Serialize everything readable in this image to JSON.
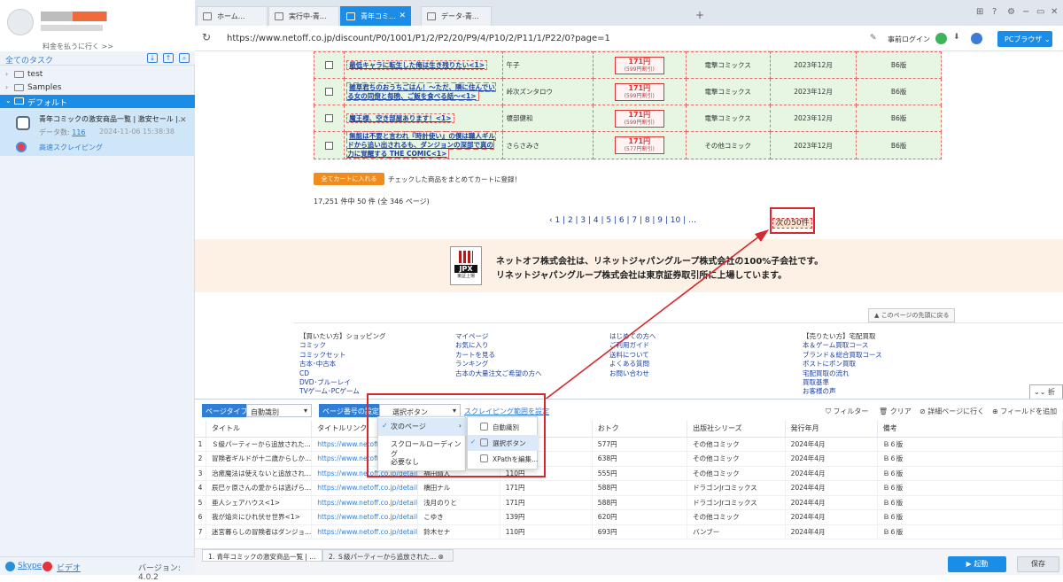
{
  "sidebar": {
    "pay_link": "料金を払うに行く >>",
    "all_tasks": "全てのタスク",
    "folders": [
      {
        "label": "test"
      },
      {
        "label": "Samples"
      },
      {
        "label": "デフォルト"
      }
    ],
    "task": {
      "name": "青年コミックの激安商品一覧 | 激安セール |...",
      "count_label": "データ数:",
      "count": "116",
      "date": "2024-11-06 15:38:38",
      "mode": "高速スクレイピング"
    },
    "bottom": {
      "skype": "Skype",
      "video": "ビデオ",
      "version": "バージョン: 4.0.2"
    }
  },
  "tabs": [
    {
      "label": "ホーム..."
    },
    {
      "label": "実行中-青..."
    },
    {
      "label": "青年コミ..."
    },
    {
      "label": "データ-青..."
    }
  ],
  "address": {
    "url": "https://www.netoff.co.jp/discount/P0/1001/P1/2/P2/20/P9/4/P10/2/P11/1/P22/0?page=1",
    "login": "事前ログイン",
    "browser": "PCブラウザ"
  },
  "page": {
    "products": [
      {
        "title": "最低キャラに転生した俺は生き残りたい<1>",
        "author": "午子",
        "price": "171円",
        "price_sub": "(599円割引)",
        "series": "電撃コミックス",
        "date": "2023年12月",
        "size": "B6版"
      },
      {
        "title": "雑草君ちのおうちごはん！～ただ、隣に住んでいる女の同僚と毎晩、ご飯を食べる話～<1>",
        "author": "峠次ズンタロウ",
        "price": "171円",
        "price_sub": "(599円割引)",
        "series": "電撃コミックス",
        "date": "2023年12月",
        "size": "B6版"
      },
      {
        "title": "魔王様、空き部屋あります！<1>",
        "author": "榎部健和",
        "price": "171円",
        "price_sub": "(599円割引)",
        "series": "電撃コミックス",
        "date": "2023年12月",
        "size": "B6版"
      },
      {
        "title": "無能は不要と言われ『時計使い』の僕は職人ギルドから追い出されるも、ダンジョンの深部で真の力に覚醒する THE COMIC<1>",
        "author": "さらさみさ",
        "price": "171円",
        "price_sub": "(577円割引)",
        "series": "その他コミック",
        "date": "2023年12月",
        "size": "B6版"
      }
    ],
    "cart_button": "全てカートに入れる",
    "cart_text": "チェックした商品をまとめてカートに登録！",
    "total": "17,251 件中 50 件 (全 346 ページ)",
    "pager": "‹ 1 | 2 | 3 | 4 | 5 | 6 | 7 | 8 | 9 | 10 | …",
    "next": "次の50件",
    "banner_line1": "ネットオフ株式会社は、リネットジャパングループ株式会社の100%子会社です。",
    "banner_line2": "リネットジャパングループ株式会社は東京証券取引所に上場しています。",
    "jpx": "JPX",
    "jpx_sub": "東証上場",
    "to_top": "▲ このページの先頭に戻る",
    "fold": "折る",
    "footer_col1": [
      "【買いたい方】ショッピング",
      "コミック",
      "コミックセット",
      "古本･中古本",
      "CD",
      "DVD･ブルーレイ",
      "TVゲーム･PCゲーム"
    ],
    "footer_col2": [
      "マイページ",
      "お気に入り",
      "カートを見る",
      "ランキング",
      "古本の大量注文ご希望の方へ"
    ],
    "footer_col3": [
      "はじめての方へ",
      "ご利用ガイド",
      "送料について",
      "よくある質問",
      "お問い合わせ"
    ],
    "footer_col4": [
      "【売りたい方】宅配買取",
      "本＆ゲーム買取コース",
      "ブランド＆総合買取コース",
      "ポストにポン買取",
      "宅配買取の流れ",
      "買取基準",
      "お客様の声"
    ]
  },
  "panel": {
    "page_type_label": "ページタイプ",
    "page_type_value": "自動識別",
    "page_num_label": "ページ番号の設定",
    "page_num_value": "選択ボタン",
    "scrape_range": "スクレイピング範囲を設定",
    "filter": "フィルター",
    "clear": "クリア",
    "detail": "詳細ページに行く",
    "add_field": "フィールドを追加",
    "columns": [
      "タイトル",
      "タイトルリンク",
      "著者",
      "売価格",
      "おトク",
      "出版社シリーズ",
      "発行年月",
      "備考"
    ],
    "rows": [
      [
        "1",
        "Ｓ級パーティーから追放された...",
        "https://www.netoff.co.jp/detail/0...",
        "",
        "171円",
        "577円",
        "その他コミック",
        "2024年4月",
        "Ｂ６版"
      ],
      [
        "2",
        "冒険者ギルドが十二歳からしか...",
        "https://www.netoff.co.jp/detail/0...",
        "",
        "110円",
        "638円",
        "その他コミック",
        "2024年4月",
        "Ｂ６版"
      ],
      [
        "3",
        "治癒魔法は使えないと追放され...",
        "https://www.netoff.co.jp/detail/0...",
        "福田晴人",
        "110円",
        "555円",
        "その他コミック",
        "2024年4月",
        "Ｂ６版"
      ],
      [
        "4",
        "辰巳ヶ原さんの愛からは逃げら...",
        "https://www.netoff.co.jp/detail/0...",
        "橋田ナル",
        "171円",
        "588円",
        "ドラゴンJrコミックス",
        "2024年4月",
        "Ｂ６版"
      ],
      [
        "5",
        "亜人シェアハウス<1>",
        "https://www.netoff.co.jp/detail/0...",
        "浅月のりと",
        "171円",
        "588円",
        "ドラゴンJrコミックス",
        "2024年4月",
        "Ｂ６版"
      ],
      [
        "6",
        "我が焔炎にひれ伏せ世界<1>",
        "https://www.netoff.co.jp/detail/0...",
        "こゆき",
        "139円",
        "620円",
        "その他コミック",
        "2024年4月",
        "Ｂ６版"
      ],
      [
        "7",
        "迷宮暮らしの冒険者はダンジョ...",
        "https://www.netoff.co.jp/detail/0...",
        "鈴木セナ",
        "110円",
        "693円",
        "バンブー",
        "2024年4月",
        "Ｂ６版"
      ]
    ],
    "dropdown": [
      "次のページ",
      "スクロールローディング",
      "必要なし"
    ],
    "submenu": [
      "自動識別",
      "選択ボタン",
      "XPathを編集..."
    ]
  },
  "bottom": {
    "tab1": "1. 青年コミックの激安商品一覧 | ...",
    "tab2": "2. Ｓ級パーティーから追放された...",
    "start": "▶ 起動",
    "save": "保存"
  },
  "colors": {
    "accent": "#1b8de6",
    "highlight": "#d8282f"
  }
}
